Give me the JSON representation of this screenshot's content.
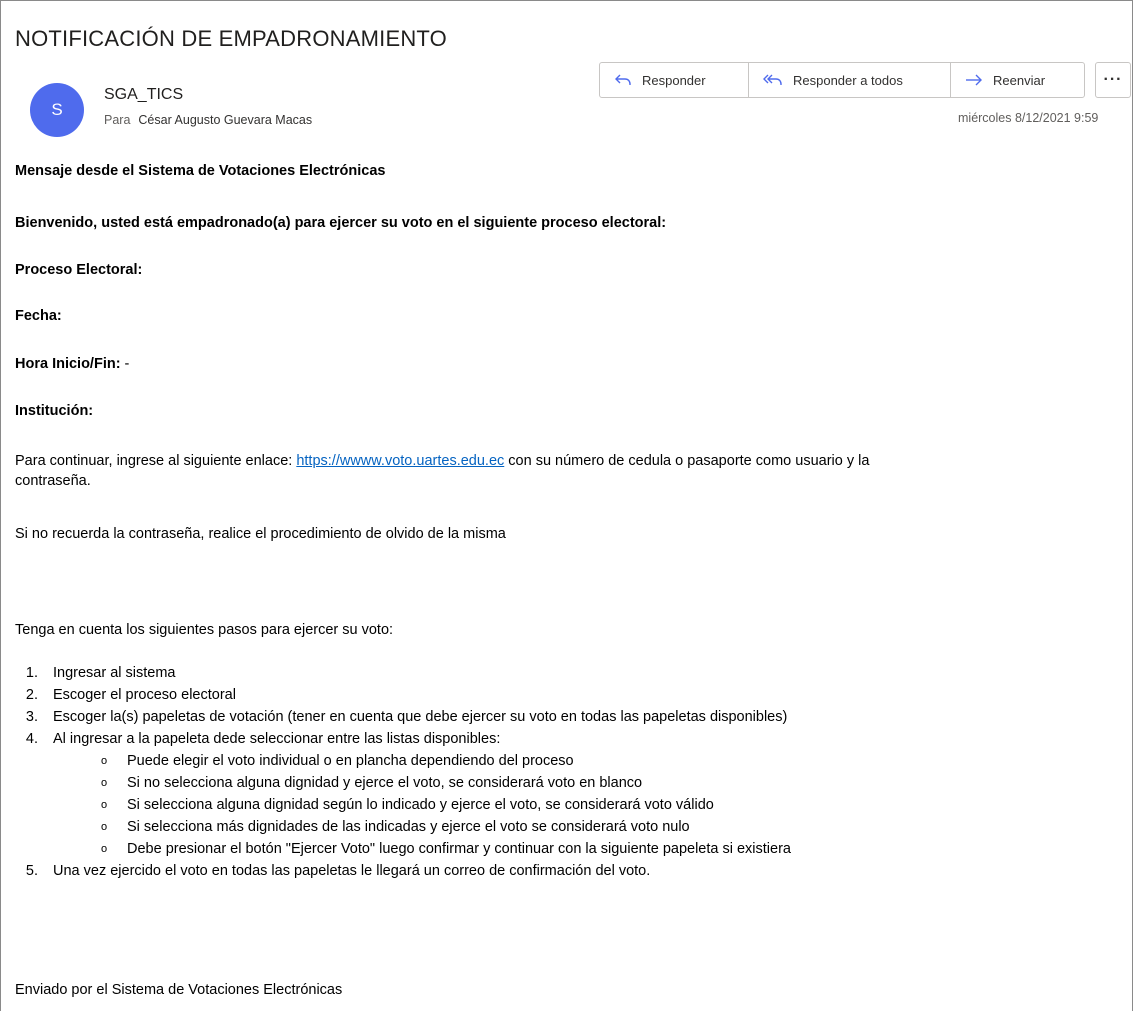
{
  "email": {
    "subject": "NOTIFICACIÓN DE EMPADRONAMIENTO",
    "sender": {
      "initial": "S",
      "name": "SGA_TICS",
      "avatar_color": "#4f6bed"
    },
    "to_label": "Para",
    "to_name": "César Augusto Guevara Macas",
    "date": "miércoles 8/12/2021 9:59",
    "actions": {
      "reply": "Responder",
      "reply_all": "Responder a todos",
      "forward": "Reenviar",
      "more": "···"
    }
  },
  "body": {
    "intro": "Mensaje desde el Sistema de Votaciones Electrónicas",
    "welcome": "Bienvenido, usted está empadronado(a) para ejercer su voto en el siguiente proceso electoral:",
    "proceso_label": "Proceso Electoral:",
    "fecha_label": "Fecha:",
    "hora_label": "Hora Inicio/Fin:",
    "hora_value": " -",
    "institucion_label": "Institución:",
    "continue_prefix": "Para continuar, ingrese al siguiente enlace: ",
    "link_text": "https://wwww.voto.uartes.edu.ec",
    "continue_suffix": " con su número de cedula o pasaporte como usuario y la",
    "continue_line2": "contraseña.",
    "forgot": "Si no recuerda la contraseña, realice el procedimiento de olvido de la misma",
    "steps_intro": "Tenga en cuenta los siguientes pasos para ejercer su voto:",
    "steps": [
      {
        "num": "1.",
        "text": "Ingresar al sistema"
      },
      {
        "num": "2.",
        "text": "Escoger el proceso electoral"
      },
      {
        "num": "3.",
        "text": "Escoger la(s) papeletas de votación (tener en cuenta que debe ejercer su voto en todas las papeletas disponibles)"
      },
      {
        "num": "4.",
        "text": "Al ingresar a la papeleta dede seleccionar entre las listas disponibles:"
      },
      {
        "num": "5.",
        "text": "Una vez ejercido el voto en todas las papeletas le llegará un correo de confirmación del voto."
      }
    ],
    "sub_steps": [
      "Puede elegir el voto individual o en plancha dependiendo del proceso",
      "Si no selecciona alguna dignidad y ejerce el voto, se considerará voto en blanco",
      "Si selecciona alguna dignidad según lo indicado y ejerce el voto, se considerará voto válido",
      "Si selecciona más dignidades de las indicadas y ejerce el voto se considerará voto nulo",
      "Debe presionar el botón \"Ejercer Voto\" luego confirmar y continuar con la siguiente papeleta si existiera"
    ],
    "sub_bullet": "o",
    "signature": "Enviado por el Sistema de Votaciones Electrónicas"
  }
}
